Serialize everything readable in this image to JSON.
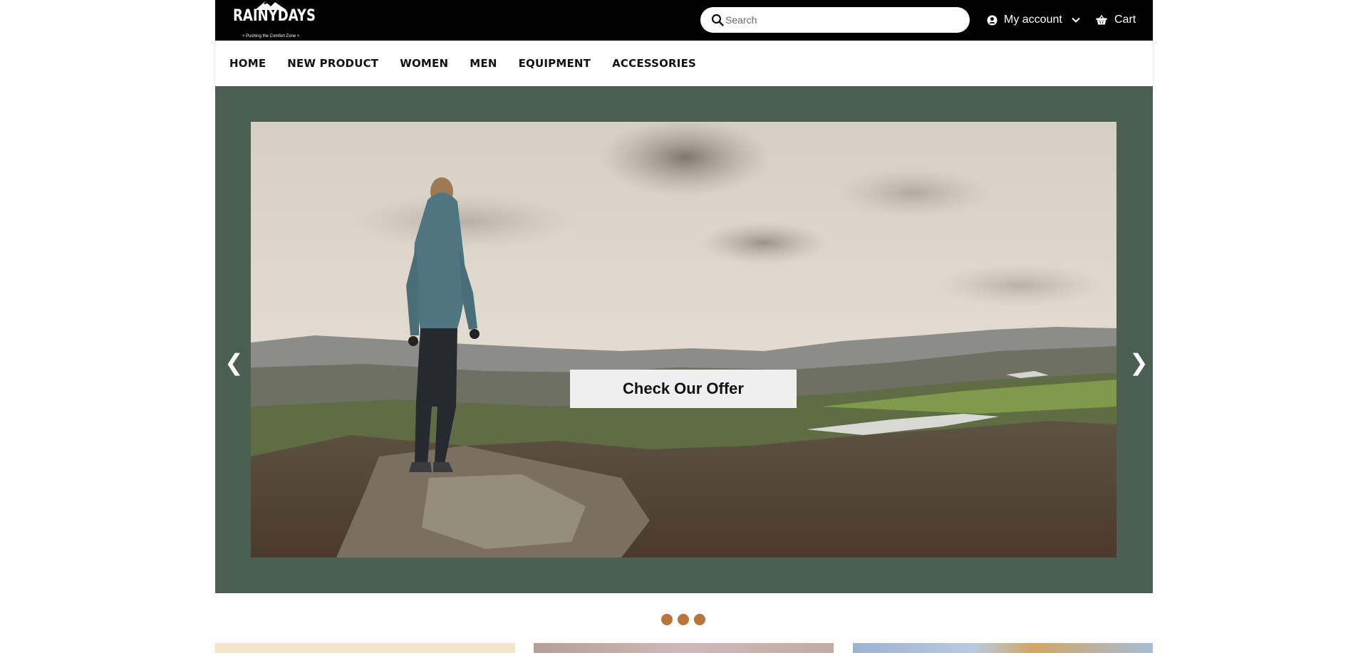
{
  "header": {
    "logo_text": "RAINYDAYS",
    "logo_tagline": "× Pushing the Comfort Zone ×",
    "search_placeholder": "Search",
    "account_label": "My account",
    "cart_label": "Cart"
  },
  "nav": {
    "items": [
      "HOME",
      "NEW PRODUCT",
      "WOMEN",
      "MEN",
      "EQUIPMENT",
      "ACCESSORIES"
    ]
  },
  "hero": {
    "cta_label": "Check Our Offer",
    "prev_arrow": "❮",
    "next_arrow": "❯",
    "dots_count": 3,
    "background_color": "#4a5e51"
  },
  "colors": {
    "topbar": "#000000",
    "dot": "#b8743a",
    "hero_frame": "#4a5e51"
  },
  "icons": [
    "search-icon",
    "user-circle-icon",
    "chevron-down-icon",
    "basket-icon",
    "chevron-left-icon",
    "chevron-right-icon"
  ]
}
